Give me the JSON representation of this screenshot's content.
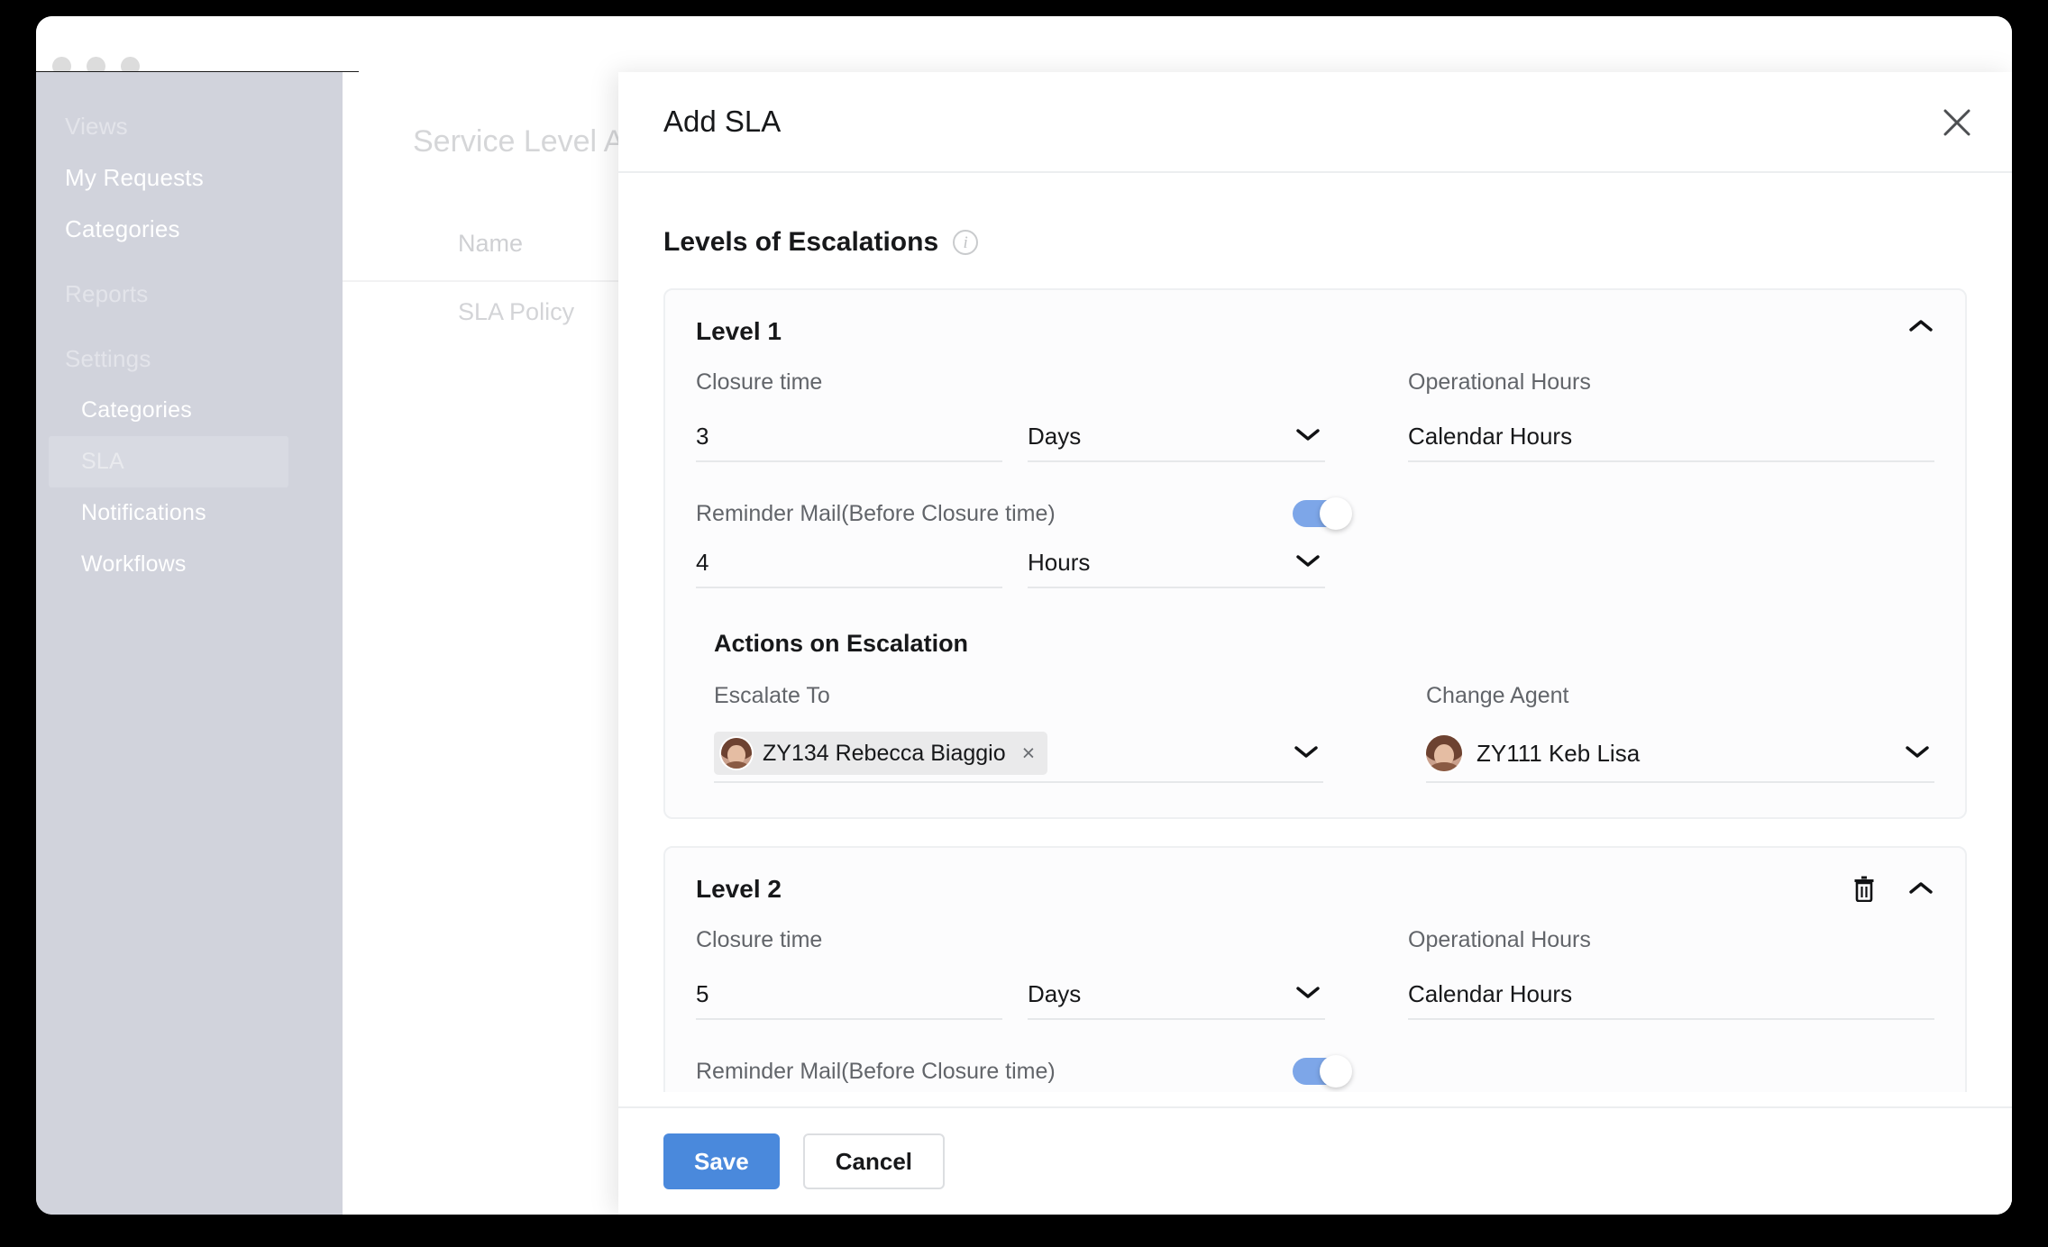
{
  "window": {
    "dots": [
      "close-dot",
      "minimize-dot",
      "maximize-dot"
    ]
  },
  "sidebar": {
    "items": [
      {
        "label": "Views",
        "level": "top",
        "active": false
      },
      {
        "label": "My Requests",
        "level": "top",
        "active": false
      },
      {
        "label": "Categories",
        "level": "top",
        "active": false
      },
      {
        "label": "Reports",
        "level": "top",
        "active": false
      },
      {
        "label": "Settings",
        "level": "top",
        "active": false
      },
      {
        "label": "Categories",
        "level": "sub",
        "active": false
      },
      {
        "label": "SLA",
        "level": "sub",
        "active": true
      },
      {
        "label": "Notifications",
        "level": "sub",
        "active": false
      },
      {
        "label": "Workflows",
        "level": "sub",
        "active": false
      }
    ]
  },
  "background_page": {
    "title": "Service Level Agree",
    "column_header": "Name",
    "row_1": "SLA Policy"
  },
  "modal": {
    "title": "Add SLA",
    "close_icon": "close-icon",
    "section": {
      "title": "Levels of Escalations",
      "info_glyph": "i"
    },
    "levels": [
      {
        "name": "Level 1",
        "collapse_icon": "chevron-up-icon",
        "has_delete": false,
        "closure_time_label": "Closure time",
        "closure_time_value": "3",
        "closure_time_unit": "Days",
        "operational_hours_label": "Operational Hours",
        "operational_hours_value": "Calendar Hours",
        "reminder_label": "Reminder Mail(Before Closure time)",
        "reminder_toggle_on": true,
        "reminder_value": "4",
        "reminder_unit": "Hours",
        "actions_title": "Actions on Escalation",
        "escalate_to_label": "Escalate To",
        "escalate_to_chip": "ZY134 Rebecca Biaggio",
        "escalate_to_remove": "×",
        "change_agent_label": "Change Agent",
        "change_agent_value": "ZY111 Keb Lisa"
      },
      {
        "name": "Level 2",
        "collapse_icon": "chevron-up-icon",
        "has_delete": true,
        "delete_icon": "trash-icon",
        "closure_time_label": "Closure time",
        "closure_time_value": "5",
        "closure_time_unit": "Days",
        "operational_hours_label": "Operational Hours",
        "operational_hours_value": "Calendar Hours",
        "reminder_label": "Reminder Mail(Before Closure time)",
        "reminder_toggle_on": true
      }
    ],
    "footer": {
      "save_label": "Save",
      "cancel_label": "Cancel"
    }
  },
  "colors": {
    "accent_blue": "#4a89dc",
    "toggle_blue": "#7da6e8",
    "sidebar_bg": "#d1d3dc",
    "card_border": "#eef0f2"
  }
}
